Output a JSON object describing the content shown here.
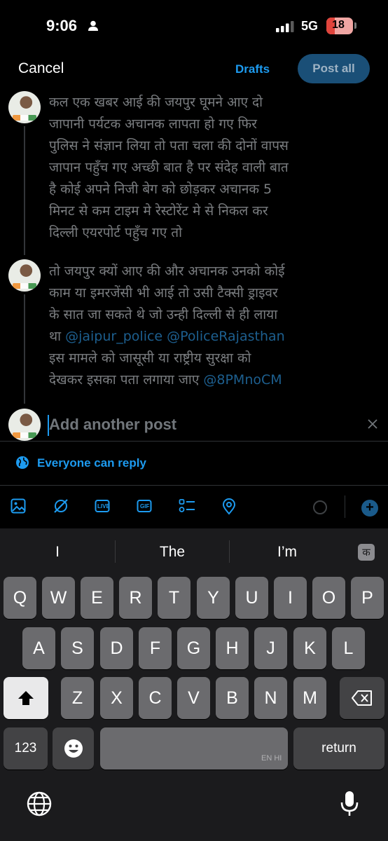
{
  "status_bar": {
    "time": "9:06",
    "network": "5G",
    "battery": "18",
    "battery_level_percent": 18
  },
  "nav": {
    "cancel": "Cancel",
    "drafts": "Drafts",
    "post_all": "Post all"
  },
  "thread": {
    "post1": {
      "text": "कल एक खबर आई की जयपुर घूमने आए दो\nजापानी पर्यटक अचानक लापता हो गए फिर\nपुलिस ने संज्ञान लिया तो पता चला की दोनों वापस\nजापान पहुँच गए अच्छी बात है पर संदेह वाली बात\nहै कोई अपने निजी बेग को छोड़कर अचानक 5\nमिनट से कम टाइम मे रेस्टोरेंट मे से निकल कर\nदिल्ली एयरपोर्ट पहुँच गए तो"
    },
    "post2": {
      "line1": "तो जयपुर क्यों आए की और अचानक उनको कोई",
      "line2": "काम या इमरजेंसी भी आई तो उसी टैक्सी ड्राइवर",
      "line3": "के सात जा सकते थे जो उन्ही दिल्ली से ही लाया",
      "line4_prefix": "था ",
      "mention1": "@jaipur_police",
      "mention2": "@PoliceRajasthan",
      "line5": "इस मामले को जासूसी या राष्ट्रीय सुरक्षा को",
      "line6_prefix": "देखकर इसका पता लगाया जाए ",
      "mention3": "@8PMnoCM"
    },
    "add_placeholder": "Add another post"
  },
  "reply_setting": "Everyone can reply",
  "toolbar": {
    "live_label": "LIVE",
    "gif_label": "GIF"
  },
  "keyboard": {
    "suggestions": [
      "I",
      "The",
      "I’m"
    ],
    "hindi_switch": "क",
    "row1": [
      "Q",
      "W",
      "E",
      "R",
      "T",
      "Y",
      "U",
      "I",
      "O",
      "P"
    ],
    "row2": [
      "A",
      "S",
      "D",
      "F",
      "G",
      "H",
      "J",
      "K",
      "L"
    ],
    "row3": [
      "Z",
      "X",
      "C",
      "V",
      "B",
      "N",
      "M"
    ],
    "numbers_key": "123",
    "space_lang": "EN HI",
    "return_key": "return"
  },
  "colors": {
    "accent": "#1d9bf0",
    "background": "#000000",
    "keyboard_bg": "#1b1b1d"
  }
}
